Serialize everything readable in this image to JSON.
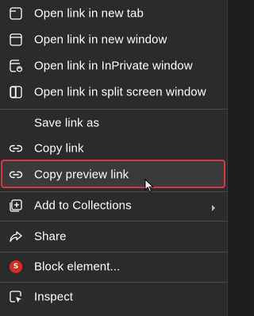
{
  "menu": {
    "items": [
      {
        "label": "Open link in new tab",
        "icon": "new-tab-icon"
      },
      {
        "label": "Open link in new window",
        "icon": "new-window-icon"
      },
      {
        "label": "Open link in InPrivate window",
        "icon": "inprivate-window-icon"
      },
      {
        "label": "Open link in split screen window",
        "icon": "split-screen-icon"
      },
      {
        "label": "Save link as",
        "icon": ""
      },
      {
        "label": "Copy link",
        "icon": "link-icon"
      },
      {
        "label": "Copy preview link",
        "icon": "link-icon"
      },
      {
        "label": "Add to Collections",
        "icon": "collections-icon"
      },
      {
        "label": "Share",
        "icon": "share-icon"
      },
      {
        "label": "Block element...",
        "icon": "adblock-icon",
        "icon_text": "S"
      },
      {
        "label": "Inspect",
        "icon": "inspect-icon"
      }
    ]
  },
  "colors": {
    "menu_bg": "#2b2b2b",
    "highlight_bg": "#3a3a3a",
    "highlight_border": "#d4373c",
    "text": "#ffffff",
    "separator": "#4a4a4a",
    "block_icon": "#d62d20"
  }
}
